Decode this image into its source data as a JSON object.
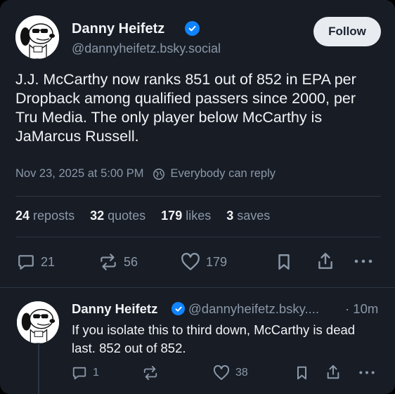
{
  "post": {
    "author_name": "Danny Heifetz",
    "author_handle": "@dannyheifetz.bsky.social",
    "follow_label": "Follow",
    "text": "J.J. McCarthy now ranks 851 out of 852 in EPA per Dropback among qualified passers since 2000, per Tru Media. The only player below McCarthy is JaMarcus Russell.",
    "timestamp": "Nov 23, 2025 at 5:00 PM",
    "reply_setting": "Everybody can reply",
    "stats": [
      {
        "count": "24",
        "label": "reposts"
      },
      {
        "count": "32",
        "label": "quotes"
      },
      {
        "count": "179",
        "label": "likes"
      },
      {
        "count": "3",
        "label": "saves"
      }
    ],
    "actions": {
      "replies": "21",
      "reposts": "56",
      "likes": "179"
    }
  },
  "reply": {
    "author_name": "Danny Heifetz",
    "author_handle": "@dannyheifetz.bsky....",
    "time": "· 10m",
    "text": "If you isolate this to third down, McCarthy is dead last. 852 out of 852.",
    "actions": {
      "replies": "1",
      "likes": "38"
    }
  },
  "colors": {
    "background": "#171c25",
    "verified": "#1083fe",
    "muted": "#8b98a8",
    "text": "#f1f3f5"
  },
  "icons": {
    "avatar": "snoopy-avatar",
    "verified": "verified-check-icon",
    "reply_setting": "globe-icon",
    "reply": "speech-bubble-icon",
    "repost": "repost-arrows-icon",
    "like": "heart-icon",
    "bookmark": "bookmark-icon",
    "share": "share-icon",
    "more": "more-dots-icon"
  }
}
